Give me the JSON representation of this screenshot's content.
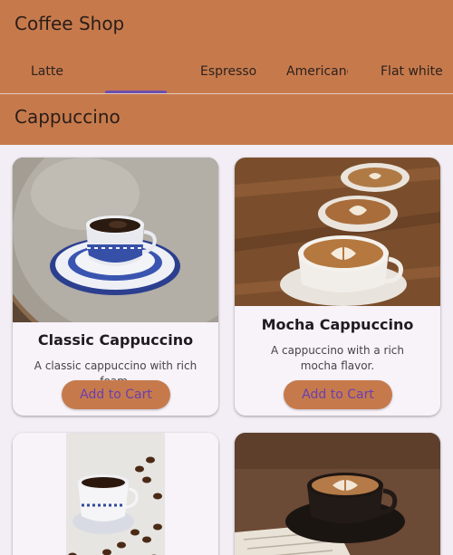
{
  "app": {
    "title": "Coffee Shop"
  },
  "tabs": [
    {
      "label": "Latte"
    },
    {
      "label": ""
    },
    {
      "label": "Espresso"
    },
    {
      "label": "Americano"
    },
    {
      "label": "Flat white"
    }
  ],
  "selected_tab_index": 1,
  "section": {
    "title": "Cappuccino"
  },
  "products": [
    {
      "name": "Classic Cappuccino",
      "description": "A classic cappuccino with rich foam.",
      "button": "Add to Cart"
    },
    {
      "name": "Mocha Cappuccino",
      "description": "A cappuccino with a rich mocha flavor.",
      "button": "Add to Cart"
    },
    {
      "name": "",
      "description": "",
      "button": ""
    },
    {
      "name": "",
      "description": "",
      "button": ""
    }
  ],
  "colors": {
    "app_bar": "#c67a4c",
    "tab_indicator": "#6d4fb0",
    "button_bg": "#c67a4c",
    "button_text": "#6a3fb0",
    "card_bg": "#f8f2f9"
  },
  "images": [
    "cup-on-marble-table-image",
    "latte-art-cups-row-image",
    "cup-with-coffee-beans-image",
    "latte-with-book-image"
  ]
}
